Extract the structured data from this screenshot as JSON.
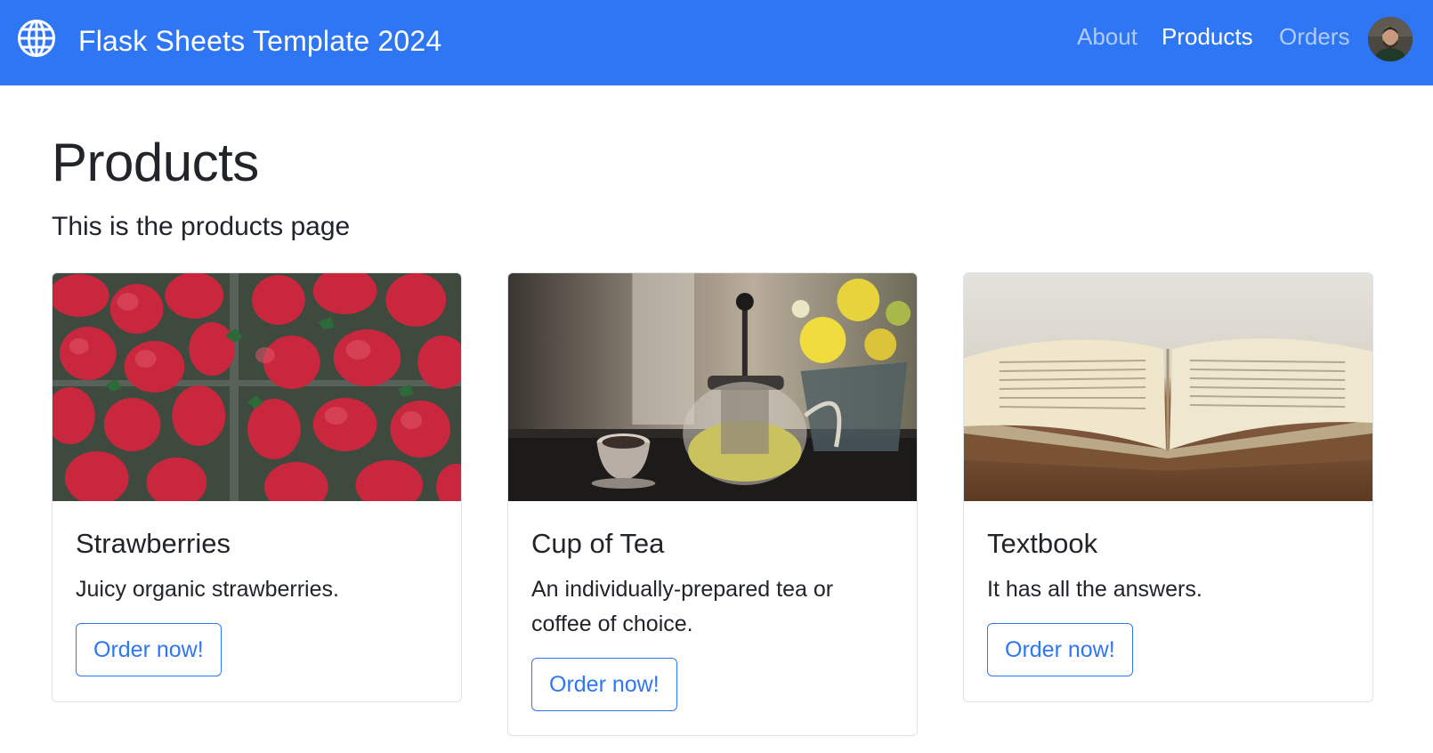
{
  "navbar": {
    "brand_icon": "globe-icon",
    "title": "Flask Sheets Template 2024",
    "links": [
      {
        "label": "About",
        "active": false
      },
      {
        "label": "Products",
        "active": true
      },
      {
        "label": "Orders",
        "active": false
      }
    ],
    "avatar_icon": "user-avatar",
    "background_color": "#2f76f4"
  },
  "main": {
    "title": "Products",
    "subtitle": "This is the products page",
    "cards": [
      {
        "image": "strawberries-photo",
        "title": "Strawberries",
        "text": "Juicy organic strawberries.",
        "button_label": "Order now!"
      },
      {
        "image": "teapot-photo",
        "title": "Cup of Tea",
        "text": "An individually-prepared tea or coffee of choice.",
        "button_label": "Order now!"
      },
      {
        "image": "open-book-photo",
        "title": "Textbook",
        "text": "It has all the answers.",
        "button_label": "Order now!"
      }
    ],
    "button_color": "#2f76f4"
  }
}
